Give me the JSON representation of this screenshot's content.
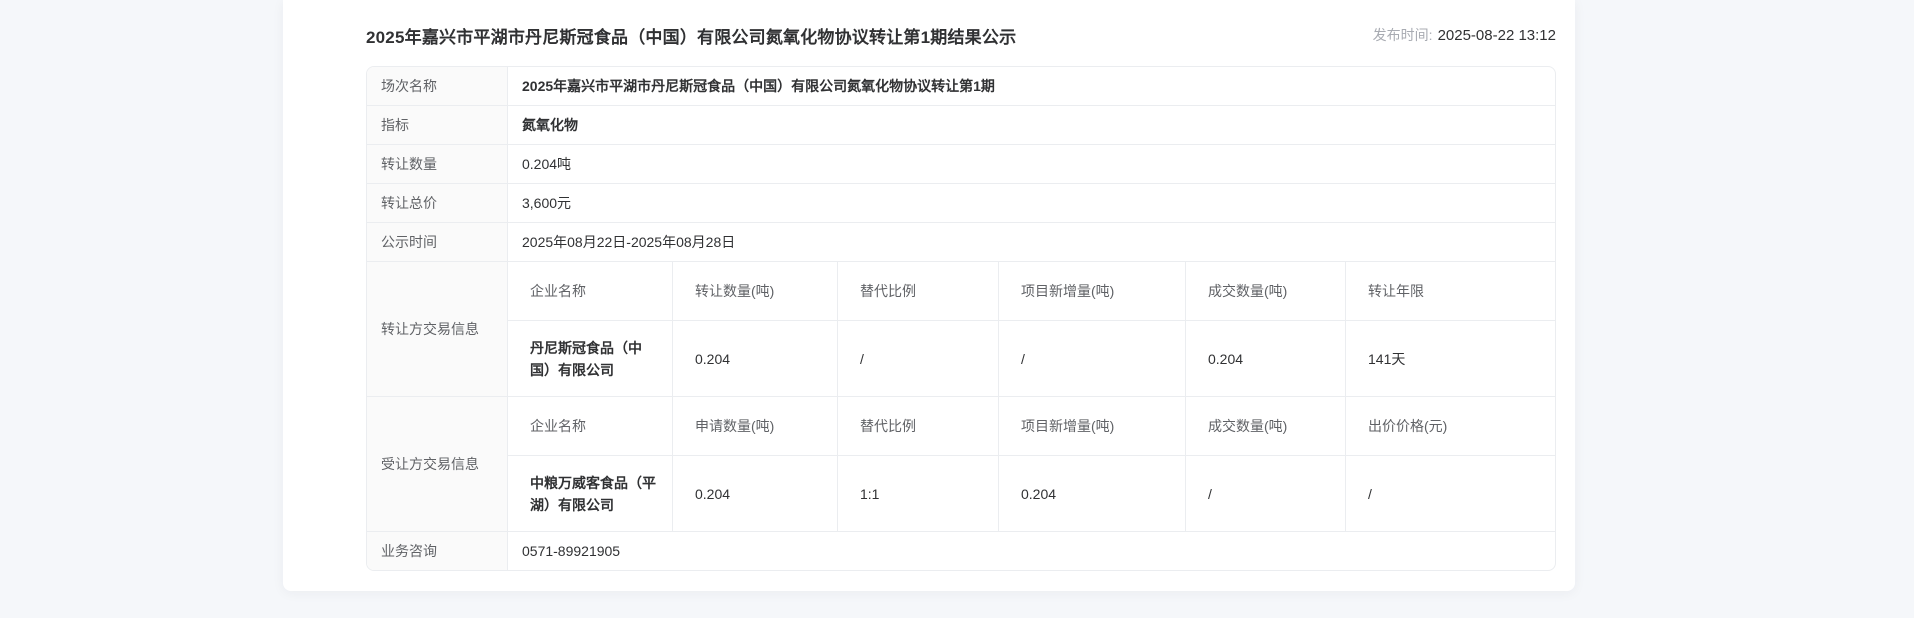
{
  "header": {
    "title": "2025年嘉兴市平湖市丹尼斯冠食品（中国）有限公司氮氧化物协议转让第1期结果公示",
    "publish_label": "发布时间:",
    "publish_time": "2025-08-22 13:12"
  },
  "table": {
    "rows": {
      "session": {
        "label": "场次名称",
        "value": "2025年嘉兴市平湖市丹尼斯冠食品（中国）有限公司氮氧化物协议转让第1期"
      },
      "indicator": {
        "label": "指标",
        "value": "氮氧化物"
      },
      "quantity": {
        "label": "转让数量",
        "value": "0.204吨"
      },
      "price": {
        "label": "转让总价",
        "value": "3,600元"
      },
      "period": {
        "label": "公示时间",
        "value": "2025年08月22日-2025年08月28日"
      },
      "consult": {
        "label": "业务咨询",
        "value": "0571-89921905"
      }
    },
    "transferor": {
      "label": "转让方交易信息",
      "headers": [
        "企业名称",
        "转让数量(吨)",
        "替代比例",
        "项目新增量(吨)",
        "成交数量(吨)",
        "转让年限"
      ],
      "row": [
        "丹尼斯冠食品（中国）有限公司",
        "0.204",
        "/",
        "/",
        "0.204",
        "141天"
      ]
    },
    "transferee": {
      "label": "受让方交易信息",
      "headers": [
        "企业名称",
        "申请数量(吨)",
        "替代比例",
        "项目新增量(吨)",
        "成交数量(吨)",
        "出价价格(元)"
      ],
      "row": [
        "中粮万威客食品（平湖）有限公司",
        "0.204",
        "1:1",
        "0.204",
        "/",
        "/"
      ]
    }
  },
  "colors": {
    "page_bg": "#f5f7fa",
    "card_bg": "#ffffff",
    "border": "#ebedf0",
    "label_bg": "#fafafa",
    "label_text": "#606266",
    "value_text": "#303133",
    "muted_text": "#a8abb2"
  }
}
